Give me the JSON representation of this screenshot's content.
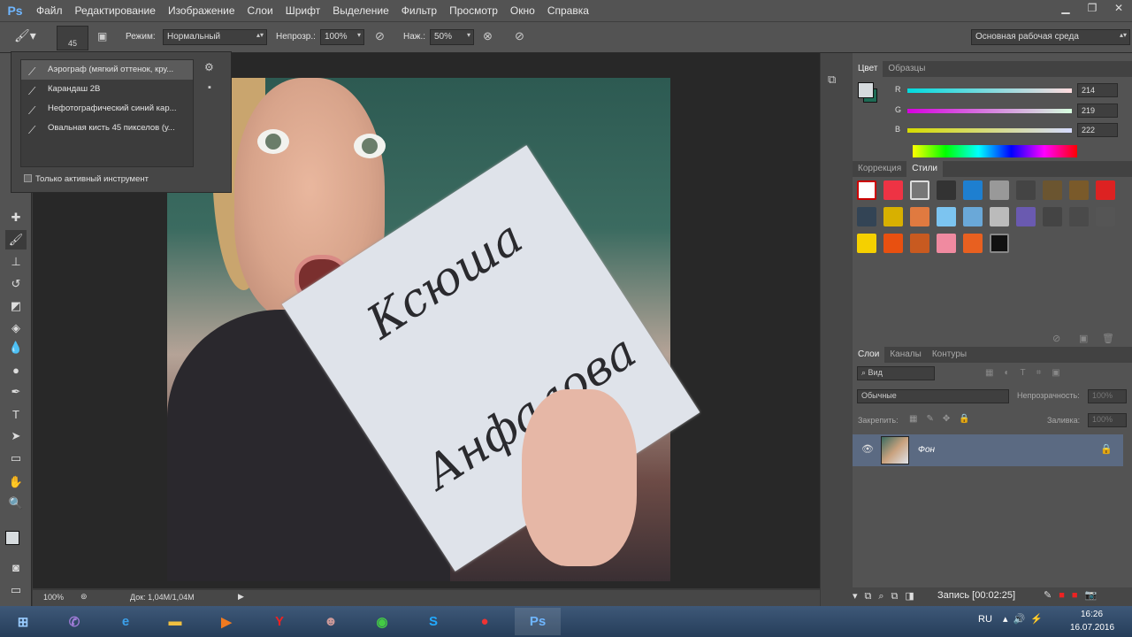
{
  "app": {
    "logo": "Ps"
  },
  "menu": [
    "Файл",
    "Редактирование",
    "Изображение",
    "Слои",
    "Шрифт",
    "Выделение",
    "Фильтр",
    "Просмотр",
    "Окно",
    "Справка"
  ],
  "options": {
    "brush_size": "45",
    "mode_label": "Режим:",
    "mode_value": "Нормальный",
    "opacity_label": "Непрозр.:",
    "opacity_value": "100%",
    "flow_label": "Наж.:",
    "flow_value": "50%",
    "workspace_value": "Основная рабочая среда"
  },
  "presets": {
    "items": [
      "Аэрограф (мягкий оттенок, кру...",
      "Карандаш 2В",
      "Нефотографический синий кар...",
      "Овальная кисть 45 пикселов (у..."
    ],
    "only_active": "Только активный инструмент"
  },
  "photo_text": {
    "line1": "Ксюша",
    "line2": "Анфалова"
  },
  "status": {
    "zoom": "100%",
    "doc": "Док: 1,04M/1,04M"
  },
  "color_panel": {
    "tabs": [
      "Цвет",
      "Образцы"
    ],
    "r_label": "R",
    "g_label": "G",
    "b_label": "B",
    "r": "214",
    "g": "219",
    "b": "222"
  },
  "styles_panel": {
    "tabs": [
      "Коррекция",
      "Стили"
    ]
  },
  "layers_panel": {
    "tabs": [
      "Слои",
      "Каналы",
      "Контуры"
    ],
    "kind": "Вид",
    "blend": "Обычные",
    "opacity_label": "Непрозрачность:",
    "opacity_value": "100%",
    "lock_label": "Закрепить:",
    "fill_label": "Заливка:",
    "fill_value": "100%",
    "layer_name": "Фон"
  },
  "recording": "Запись [00:02:25]",
  "taskbar": {
    "lang": "RU",
    "time": "16:26",
    "date": "16.07.2016"
  },
  "colors": {
    "ui_bg": "#535353",
    "canvas_bg": "#282828",
    "accent_layer": "#5b6a82",
    "fg_swatch": "#d6dbde",
    "bg_swatch": "#1e6b55"
  }
}
